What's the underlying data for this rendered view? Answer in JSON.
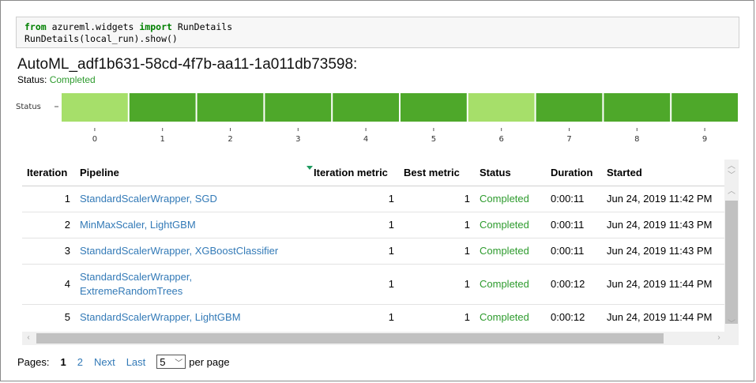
{
  "code": {
    "line1_kw1": "from",
    "line1_mod": " azureml.widgets ",
    "line1_kw2": "import",
    "line1_name": " RunDetails",
    "line2": "RunDetails(local_run).show()"
  },
  "run": {
    "title": "AutoML_adf1b631-58cd-4f7b-aa11-1a011db73598:",
    "status_label": "Status: ",
    "status_value": "Completed"
  },
  "colors": {
    "completed_dark": "#4ea82a",
    "completed_light": "#a6df6a",
    "link": "#337ab7",
    "status_green": "#2e9b2e"
  },
  "chart_data": {
    "type": "heatmap",
    "ylabel": "Status",
    "x": [
      0,
      1,
      2,
      3,
      4,
      5,
      6,
      7,
      8,
      9
    ],
    "shade": [
      "light",
      "dark",
      "dark",
      "dark",
      "dark",
      "dark",
      "light",
      "dark",
      "dark",
      "dark"
    ]
  },
  "table": {
    "columns": [
      "Iteration",
      "Pipeline",
      "Iteration metric",
      "Best metric",
      "Status",
      "Duration",
      "Started"
    ],
    "sorted_column": "Iteration metric",
    "rows": [
      {
        "iteration": "1",
        "pipeline": "StandardScalerWrapper, SGD",
        "iteration_metric": "1",
        "best_metric": "1",
        "status": "Completed",
        "duration": "0:00:11",
        "started": "Jun 24, 2019 11:42 PM"
      },
      {
        "iteration": "2",
        "pipeline": "MinMaxScaler, LightGBM",
        "iteration_metric": "1",
        "best_metric": "1",
        "status": "Completed",
        "duration": "0:00:11",
        "started": "Jun 24, 2019 11:43 PM"
      },
      {
        "iteration": "3",
        "pipeline": "StandardScalerWrapper, XGBoostClassifier",
        "iteration_metric": "1",
        "best_metric": "1",
        "status": "Completed",
        "duration": "0:00:11",
        "started": "Jun 24, 2019 11:43 PM"
      },
      {
        "iteration": "4",
        "pipeline": "StandardScalerWrapper, ExtremeRandomTrees",
        "iteration_metric": "1",
        "best_metric": "1",
        "status": "Completed",
        "duration": "0:00:12",
        "started": "Jun 24, 2019 11:44 PM"
      },
      {
        "iteration": "5",
        "pipeline": "StandardScalerWrapper, LightGBM",
        "iteration_metric": "1",
        "best_metric": "1",
        "status": "Completed",
        "duration": "0:00:12",
        "started": "Jun 24, 2019 11:44 PM"
      }
    ]
  },
  "pager": {
    "label": "Pages:",
    "current": "1",
    "page2": "2",
    "next": "Next",
    "last": "Last",
    "page_size": "5",
    "per_page": "per page"
  },
  "icons": {
    "scroll_up": "chevron-up-icon",
    "scroll_down": "chevron-down-icon",
    "scroll_left": "chevron-left-icon",
    "scroll_right": "chevron-right-icon",
    "dropdown": "chevron-down-icon",
    "sort": "sort-desc-icon"
  }
}
